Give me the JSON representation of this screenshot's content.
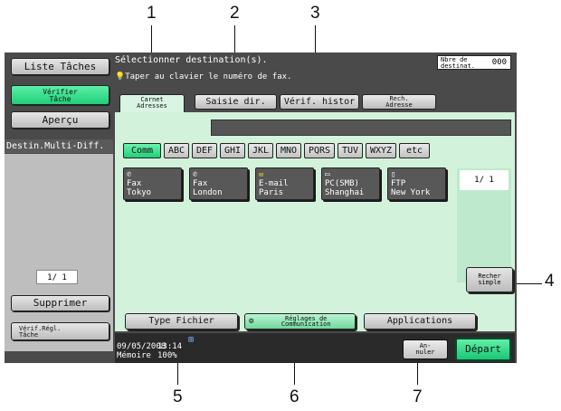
{
  "callouts": [
    "1",
    "2",
    "3",
    "4",
    "5",
    "6",
    "7"
  ],
  "left": {
    "task_list": "Liste Tâches",
    "check_task": [
      "Vérifier",
      "Tâche"
    ],
    "preview": "Aperçu",
    "multi_diff": "Destin.Multi-Diff.",
    "page": "1/ 1",
    "delete": "Supprimer",
    "check_settings": [
      "Vérif.Régl.",
      "Tâche"
    ]
  },
  "header": {
    "line1": "Sélectionner destination(s).",
    "line2": "Taper au clavier le numéro de fax.",
    "count_label": [
      "Nbre de",
      "destinat."
    ],
    "count_value": "000"
  },
  "tabs": {
    "address_book": [
      "Carnet",
      "Adresses"
    ],
    "direct_input": "Saisie dir.",
    "history": "Vérif. histor",
    "search": [
      "Rech.",
      "Adresse"
    ]
  },
  "index_tabs": [
    "Comm",
    "ABC",
    "DEF",
    "GHI",
    "JKL",
    "MNO",
    "PQRS",
    "TUV",
    "WXYZ",
    "etc"
  ],
  "destinations": [
    {
      "type": "Fax",
      "name": "Tokyo",
      "icon": "fax-icon"
    },
    {
      "type": "Fax",
      "name": "London",
      "icon": "fax-icon"
    },
    {
      "type": "E-mail",
      "name": "Paris",
      "icon": "email-icon"
    },
    {
      "type": "PC(SMB)",
      "name": "Shanghai",
      "icon": "pc-icon"
    },
    {
      "type": "FTP",
      "name": "New York",
      "icon": "ftp-icon"
    }
  ],
  "page_indicator": "1/ 1",
  "simple_search": [
    "Recher",
    "simple"
  ],
  "bottom": {
    "file_type": "Type Fichier",
    "comm_settings": [
      "Réglages de",
      "Communication"
    ],
    "applications": "Applications"
  },
  "status": {
    "date": "09/05/2008",
    "memory": "Mémoire",
    "time": "13:14",
    "percent": "100%",
    "cancel": [
      "An-",
      "nuler"
    ],
    "start": "Départ"
  },
  "colors": {
    "accent_green": "#1fcf78",
    "content_bg": "#d2f2dc",
    "panel_bg": "#4a4a4a"
  }
}
